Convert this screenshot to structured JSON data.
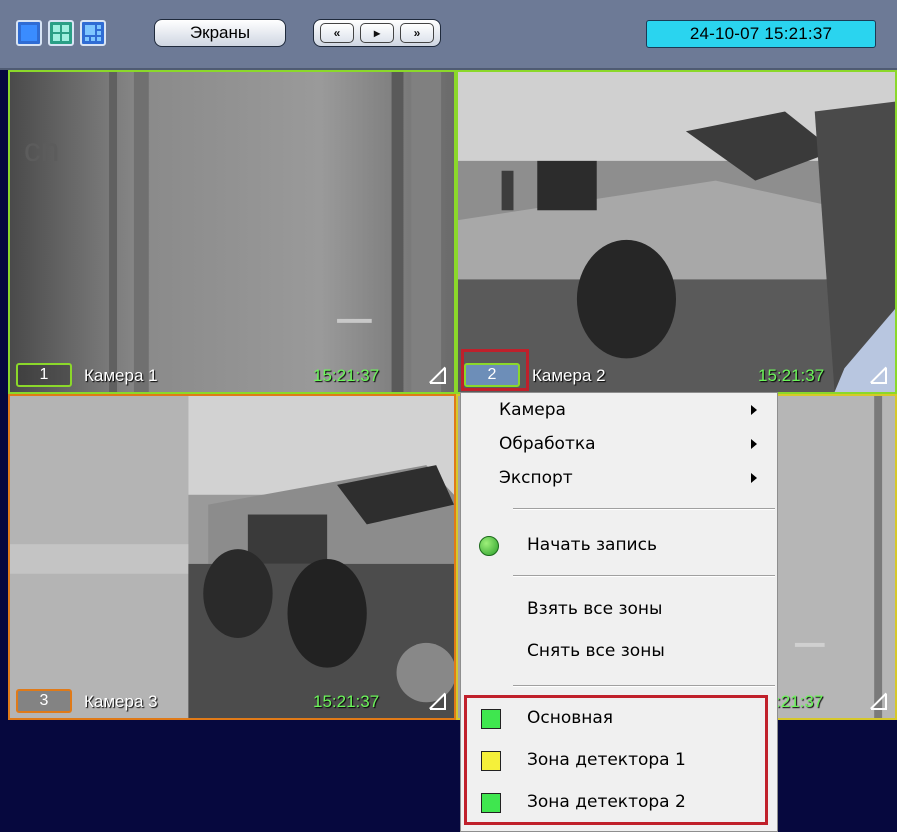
{
  "toolbar": {
    "screens_label": "Экраны",
    "prev_label": "«",
    "play_label": "▸",
    "next_label": "»",
    "clock": "24-10-07   15:21:37"
  },
  "cameras": [
    {
      "num": "1",
      "name": "Камера 1",
      "time": "15:21:37",
      "frame_color": "#8bd82a"
    },
    {
      "num": "2",
      "name": "Камера 2",
      "time": "15:21:37",
      "frame_color": "#8bd82a"
    },
    {
      "num": "3",
      "name": "Камера 3",
      "time": "15:21:37",
      "frame_color": "#e07a18"
    },
    {
      "time": ":21:37",
      "frame_color": "#d6c82a"
    }
  ],
  "context_menu": {
    "items": [
      "Камера",
      "Обработка",
      "Экспорт"
    ],
    "start_recording": "Начать запись",
    "arm_all": "Взять все зоны",
    "disarm_all": "Снять все зоны",
    "zones": [
      {
        "label": "Основная",
        "color": "#3fe64f"
      },
      {
        "label": "Зона детектора 1",
        "color": "#f5f03a"
      },
      {
        "label": "Зона детектора 2",
        "color": "#3fe64f"
      }
    ]
  },
  "colors": {
    "highlight": "#c0202b",
    "background": "#06083e"
  }
}
